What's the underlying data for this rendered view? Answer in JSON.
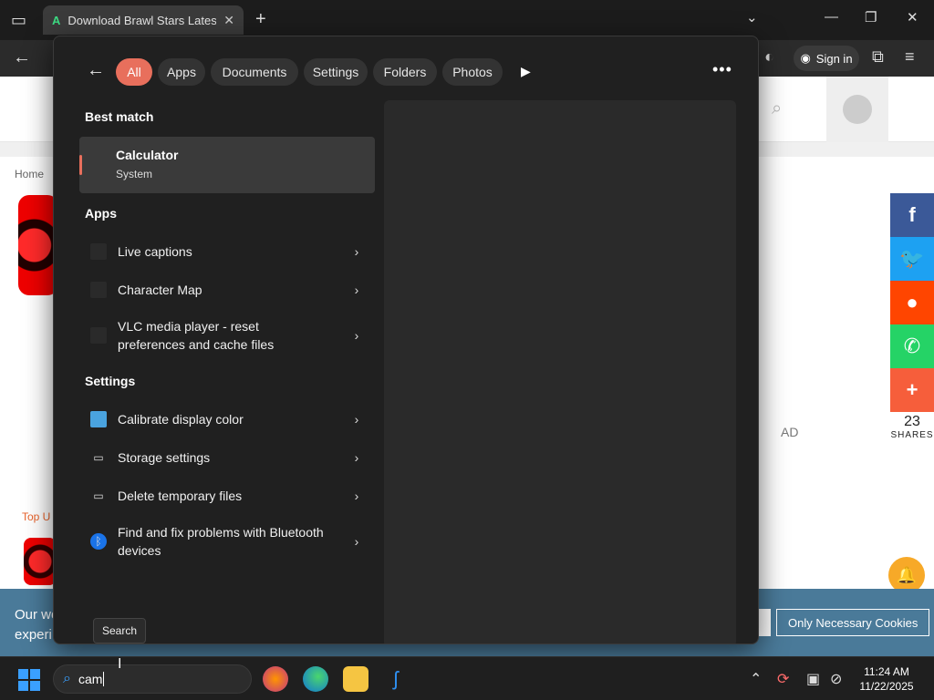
{
  "browser": {
    "tab_title": "Download Brawl Stars Latest Ve",
    "signin_label": "Sign in"
  },
  "webpage": {
    "breadcrumb": "Home",
    "top_label": "Top U",
    "ad_label": "AD",
    "share_count": "23",
    "share_label": "SHARES",
    "cookie_text_line1": "Our we",
    "cookie_text_line2": "experi",
    "cookie_button": "Only Necessary Cookies"
  },
  "flyout": {
    "filters": [
      {
        "label": "All",
        "active": true
      },
      {
        "label": "Apps"
      },
      {
        "label": "Documents"
      },
      {
        "label": "Settings"
      },
      {
        "label": "Folders"
      },
      {
        "label": "Photos"
      }
    ],
    "best_match_heading": "Best match",
    "best_match": {
      "name": "Calculator",
      "sub": "System"
    },
    "apps_heading": "Apps",
    "apps": [
      {
        "label": "Live captions"
      },
      {
        "label": "Character Map"
      },
      {
        "label": "VLC media player - reset preferences and cache files"
      }
    ],
    "settings_heading": "Settings",
    "settings": [
      {
        "label": "Calibrate display color",
        "icon": "monitor-icon"
      },
      {
        "label": "Storage settings",
        "icon": "storage-icon"
      },
      {
        "label": "Delete temporary files",
        "icon": "storage-icon"
      },
      {
        "label": "Find and fix problems with Bluetooth devices",
        "icon": "bluetooth-icon"
      }
    ],
    "tooltip": "Search"
  },
  "taskbar": {
    "search_value": "cam",
    "time": "11:24 AM",
    "date": "11/22/2025"
  }
}
